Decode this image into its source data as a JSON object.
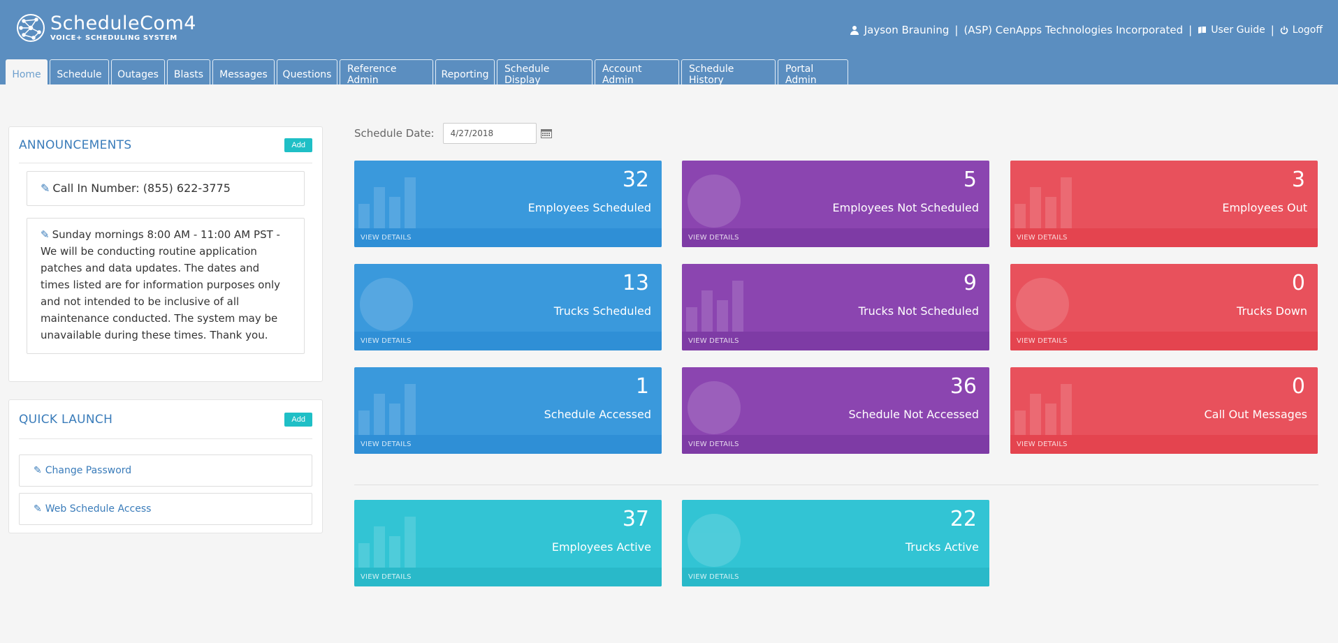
{
  "app": {
    "logo_name": "ScheduleCom4",
    "logo_tagline": "VOICE+ SCHEDULING SYSTEM"
  },
  "user": {
    "name": "Jayson Brauning",
    "company": "(ASP) CenApps Technologies Incorporated",
    "guide_label": "User Guide",
    "logoff_label": "Logoff"
  },
  "tabs": [
    {
      "label": "Home"
    },
    {
      "label": "Schedule"
    },
    {
      "label": "Outages"
    },
    {
      "label": "Blasts"
    },
    {
      "label": "Messages"
    },
    {
      "label": "Questions"
    },
    {
      "label": "Reference Admin"
    },
    {
      "label": "Reporting"
    },
    {
      "label": "Schedule Display"
    },
    {
      "label": "Account Admin"
    },
    {
      "label": "Schedule History"
    },
    {
      "label": "Portal Admin"
    }
  ],
  "announcements": {
    "title": "ANNOUNCEMENTS",
    "add_label": "Add",
    "items": [
      {
        "text": "Call In Number: (855) 622-3775"
      },
      {
        "text": "Sunday mornings 8:00 AM - 11:00 AM PST - We will be conducting routine application patches and data updates. The dates and times listed are for information purposes only and not intended to be inclusive of all maintenance conducted. The system may be unavailable during these times. Thank you."
      }
    ]
  },
  "quick_launch": {
    "title": "QUICK LAUNCH",
    "add_label": "Add",
    "items": [
      {
        "label": "Change Password"
      },
      {
        "label": "Web Schedule Access"
      }
    ]
  },
  "schedule": {
    "date_label": "Schedule Date:",
    "date_value": "4/27/2018"
  },
  "footer_label": "VIEW DETAILS",
  "tiles": [
    {
      "value": "32",
      "label": "Employees Scheduled",
      "color": "#3a99dc",
      "icon": "bar-chart-icon"
    },
    {
      "value": "5",
      "label": "Employees Not Scheduled",
      "color": "#8b45b0",
      "icon": "globe-icon"
    },
    {
      "value": "3",
      "label": "Employees Out",
      "color": "#e8515c",
      "icon": "bar-chart-icon"
    },
    {
      "value": "13",
      "label": "Trucks Scheduled",
      "color": "#3a99dc",
      "icon": "globe-icon"
    },
    {
      "value": "9",
      "label": "Trucks Not Scheduled",
      "color": "#8b45b0",
      "icon": "bar-chart-icon"
    },
    {
      "value": "0",
      "label": "Trucks Down",
      "color": "#e8515c",
      "icon": "globe-icon"
    },
    {
      "value": "1",
      "label": "Schedule Accessed",
      "color": "#3a99dc",
      "icon": "bar-chart-icon"
    },
    {
      "value": "36",
      "label": "Schedule Not Accessed",
      "color": "#8b45b0",
      "icon": "globe-icon"
    },
    {
      "value": "0",
      "label": "Call Out Messages",
      "color": "#e8515c",
      "icon": "bar-chart-icon"
    },
    {
      "value": "37",
      "label": "Employees Active",
      "color": "#32c4d4",
      "icon": "bar-chart-icon"
    },
    {
      "value": "22",
      "label": "Trucks Active",
      "color": "#32c4d4",
      "icon": "globe-icon"
    }
  ]
}
